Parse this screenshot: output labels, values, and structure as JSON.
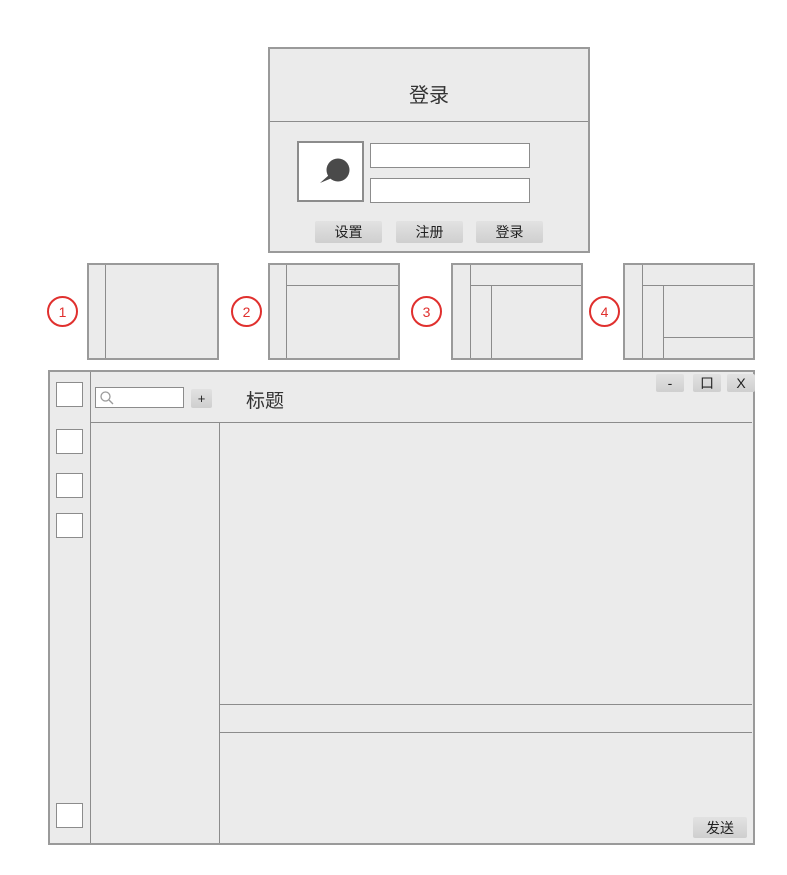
{
  "login": {
    "title": "登录",
    "buttons": {
      "settings": "设置",
      "register": "注册",
      "login": "登录"
    }
  },
  "layouts": [
    {
      "number": "1"
    },
    {
      "number": "2"
    },
    {
      "number": "3"
    },
    {
      "number": "4"
    }
  ],
  "chat": {
    "add_label": "+",
    "title": "标题",
    "minimize_label": "-",
    "maximize_label": "口",
    "close_label": "X",
    "send_label": "发送"
  },
  "colors": {
    "panel": "#ebebeb",
    "border": "#9a9a9a",
    "badge": "#e0302e"
  }
}
